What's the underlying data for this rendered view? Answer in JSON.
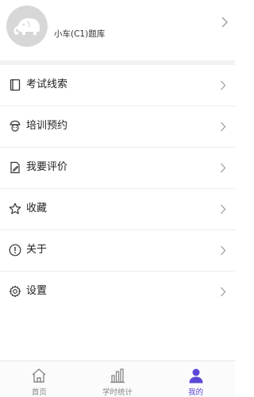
{
  "profile": {
    "name": "小车(C1)题库"
  },
  "menu": {
    "items": [
      {
        "label": "考试线索",
        "icon": "book-icon"
      },
      {
        "label": "培训预约",
        "icon": "instructor-icon"
      },
      {
        "label": "我要评价",
        "icon": "review-icon"
      },
      {
        "label": "收藏",
        "icon": "star-icon"
      },
      {
        "label": "关于",
        "icon": "info-icon"
      },
      {
        "label": "设置",
        "icon": "gear-icon"
      }
    ]
  },
  "tabbar": {
    "tabs": [
      {
        "label": "首页",
        "icon": "home-icon",
        "active": false
      },
      {
        "label": "学时统计",
        "icon": "bar-chart-icon",
        "active": false
      },
      {
        "label": "我的",
        "icon": "person-icon",
        "active": true
      }
    ]
  },
  "colors": {
    "accent": "#5a49d6",
    "inactive": "#888888",
    "avatar_bg": "#d7d7d7"
  }
}
